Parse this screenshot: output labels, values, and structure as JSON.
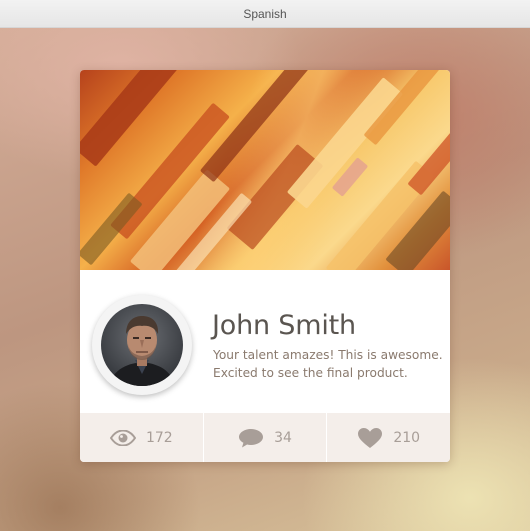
{
  "window": {
    "title": "Spanish"
  },
  "profile": {
    "name": "John Smith",
    "message": "Your talent amazes! This is awesome. Excited to see the final product."
  },
  "stats": {
    "views": {
      "icon": "eye-icon",
      "count": "172"
    },
    "comments": {
      "icon": "speech-bubble-icon",
      "count": "34"
    },
    "likes": {
      "icon": "heart-icon",
      "count": "210"
    }
  },
  "colors": {
    "name_text": "#5a5550",
    "message_text": "#8a7a6e",
    "stats_background": "#f4eeea",
    "stats_icon": "#a89e98"
  }
}
